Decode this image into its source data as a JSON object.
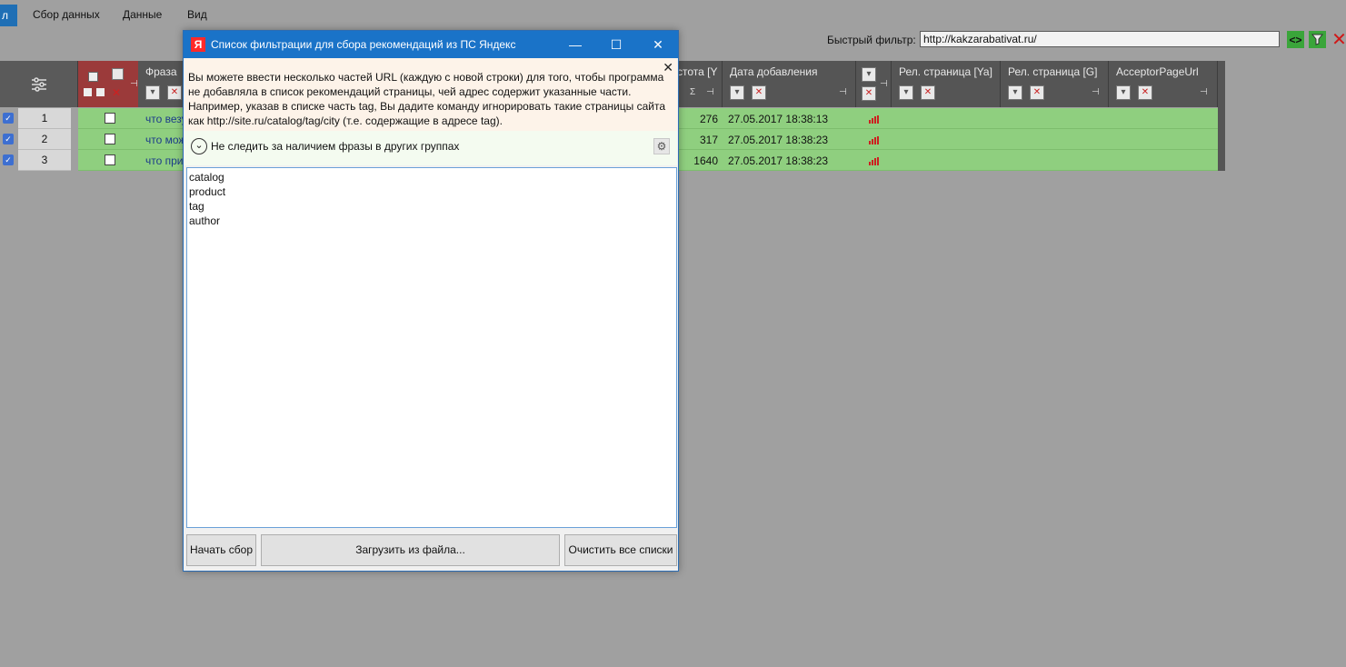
{
  "menu": {
    "first_label": "л",
    "items": [
      "Сбор данных",
      "Данные",
      "Вид"
    ]
  },
  "quick_filter": {
    "label": "Быстрый фильтр:",
    "value": "http://kakzarabativat.ru/"
  },
  "grid": {
    "columns": {
      "phrase": "Фраза",
      "freq": "стота [Y",
      "freq_sigma": "Σ",
      "date": "Дата добавления",
      "rel_ya": "Рел. страница [Ya]",
      "rel_g": "Рел. страница [G]",
      "acceptor": "AcceptorPageUrl"
    },
    "rows": [
      {
        "num": "1",
        "phrase": "что везу",
        "freq": "276",
        "date": "27.05.2017 18:38:13"
      },
      {
        "num": "2",
        "phrase": "что мож",
        "freq": "317",
        "date": "27.05.2017 18:38:23"
      },
      {
        "num": "3",
        "phrase": "что при",
        "freq": "1640",
        "date": "27.05.2017 18:38:23"
      }
    ]
  },
  "dialog": {
    "icon_letter": "Я",
    "title": "Список фильтрации для сбора рекомендаций из ПС Яндекс",
    "minimize": "—",
    "maximize": "☐",
    "close": "✕",
    "info_lines": [
      "Вы можете ввести несколько частей URL (каждую с новой строки) для того, чтобы программа",
      "не добавляла в список рекомендаций страницы, чей адрес содержит указанные части.",
      "Например, указав в списке часть tag, Вы дадите команду игнорировать такие страницы сайта",
      "как http://site.ru/catalog/tag/city (т.е. содержащие в адресе tag)."
    ],
    "info_close": "✕",
    "option_label": "Не следить за наличием фразы в других группах",
    "textarea_lines": [
      "catalog",
      "product",
      "tag",
      "author"
    ],
    "buttons": {
      "start": "Начать сбор",
      "load": "Загрузить из файла...",
      "clear": "Очистить все списки"
    }
  },
  "colors": {
    "row_green": "#8fcf7f",
    "title_blue": "#1a73c8",
    "header_gray": "#555555",
    "checkbox_col_red": "#9b3a3a"
  }
}
